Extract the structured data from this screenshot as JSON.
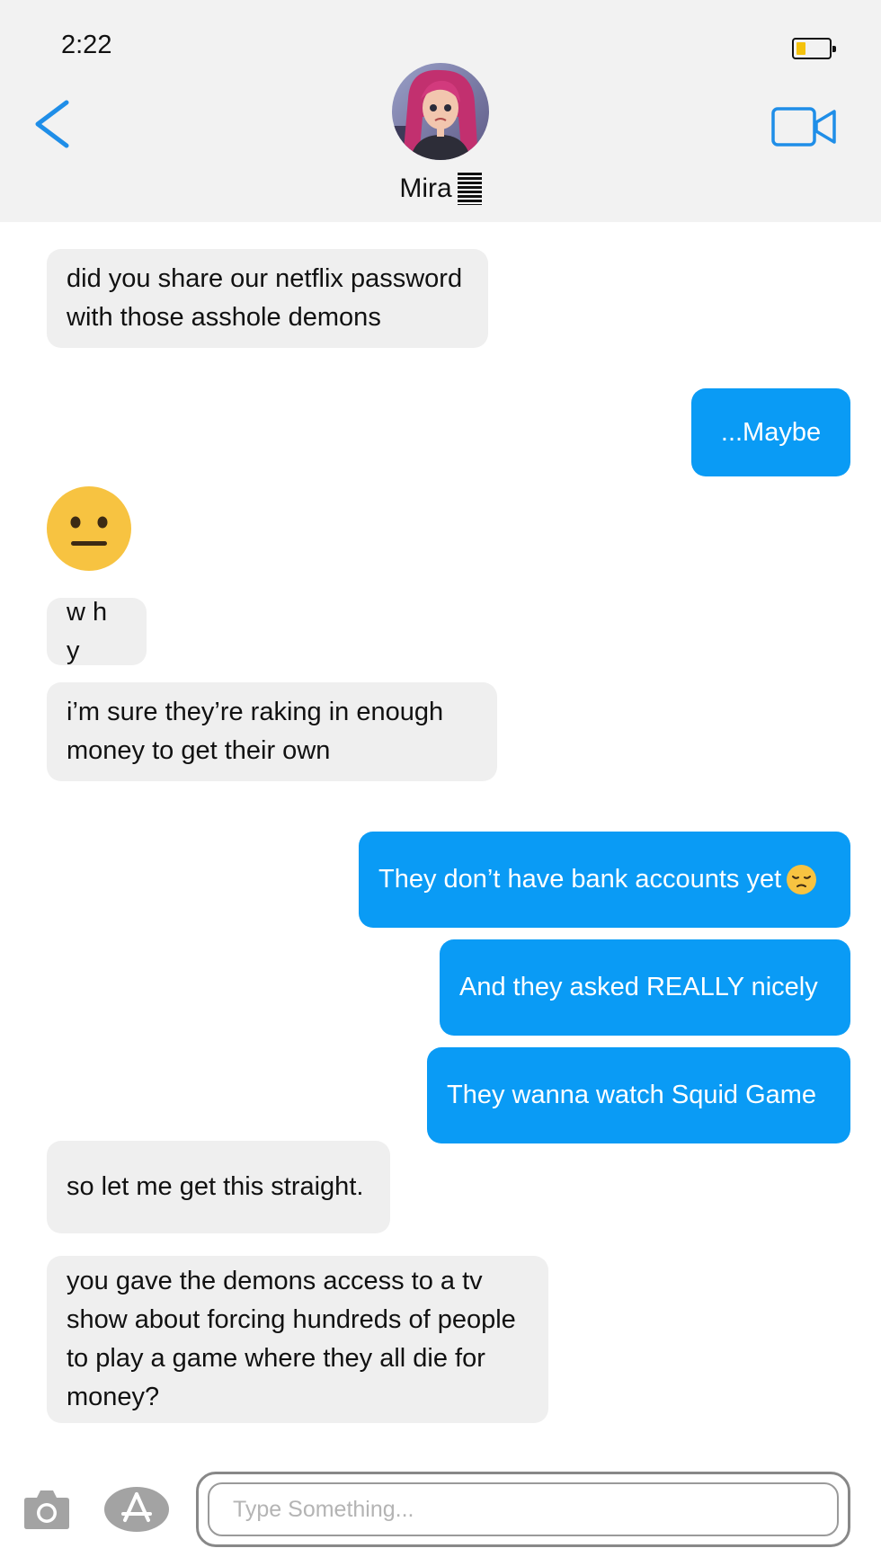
{
  "status_bar": {
    "time": "2:22",
    "battery_level": 0.3,
    "battery_color": "#f4c20d"
  },
  "header": {
    "contact_name": "Mira",
    "back_icon": "chevron-left-icon",
    "video_icon": "video-camera-icon",
    "accent_color": "#0a9bf5"
  },
  "messages": [
    {
      "from": "contact",
      "text": "did you share our netflix password with those asshole demons"
    },
    {
      "from": "me",
      "text": "...Maybe"
    },
    {
      "from": "contact",
      "emoji": "neutral-face-emoji"
    },
    {
      "from": "contact",
      "text": "w h y"
    },
    {
      "from": "contact",
      "text": "i’m sure they’re raking in enough money to get their own"
    },
    {
      "from": "me",
      "text": "They don’t have bank accounts yet",
      "emoji": "pensive-face-emoji"
    },
    {
      "from": "me",
      "text": "And they asked REALLY nicely"
    },
    {
      "from": "me",
      "text": "They wanna watch Squid Game"
    },
    {
      "from": "contact",
      "text": "so let me get this straight."
    },
    {
      "from": "contact",
      "text": "you gave the demons access to a tv show about forcing hundreds of people to play a game where they all die for money?"
    }
  ],
  "composer": {
    "placeholder": "Type Something...",
    "value": "",
    "camera_icon": "camera-icon",
    "app_icon": "app-store-icon"
  },
  "colors": {
    "incoming_bubble": "#efefef",
    "outgoing_bubble": "#0a9bf5",
    "header_bg": "#f2f2f2"
  }
}
